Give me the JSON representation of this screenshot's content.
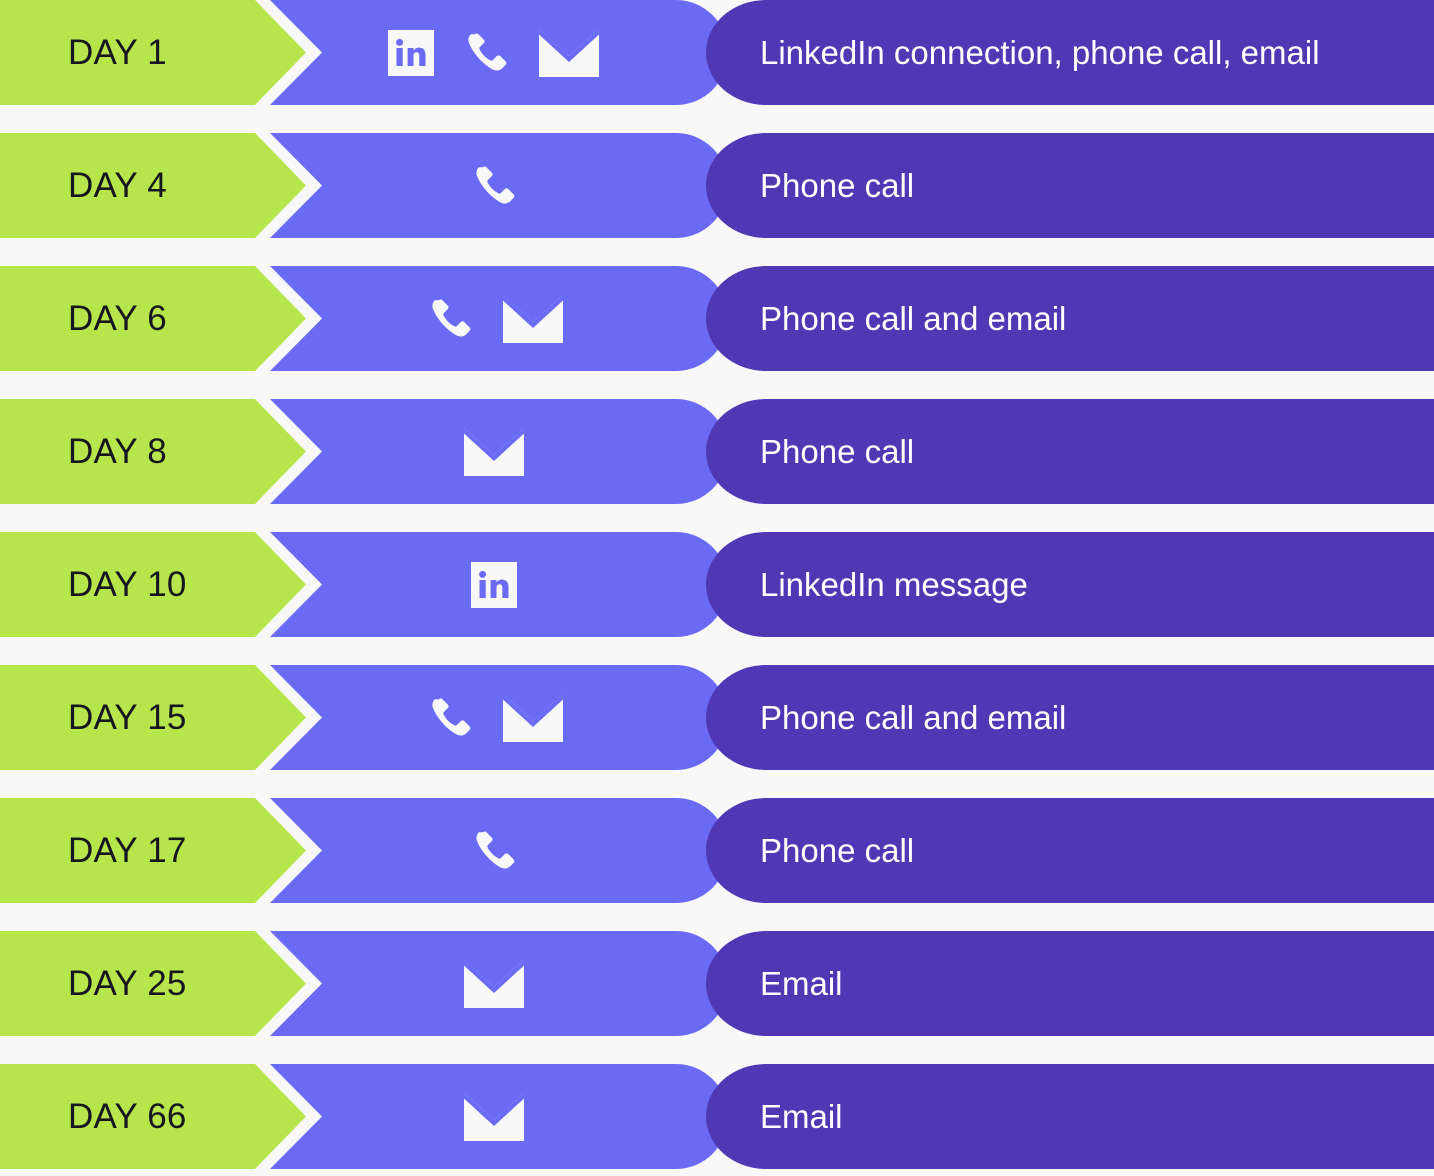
{
  "meta": {
    "title": "Sales Outreach Cadence Timeline",
    "background_color": "#f8f8f8",
    "day_segment_color": "#b6e64b",
    "icon_segment_color": "#6a6af5",
    "description_segment_color": "#5038b5",
    "day_text_color": "#16161f",
    "description_text_color": "#ffffff"
  },
  "rows": [
    {
      "day": "DAY 1",
      "icons": [
        "linkedin-icon",
        "phone-icon",
        "email-icon"
      ],
      "description": "LinkedIn connection, phone call, email"
    },
    {
      "day": "DAY 4",
      "icons": [
        "phone-icon"
      ],
      "description": "Phone call"
    },
    {
      "day": "DAY 6",
      "icons": [
        "phone-icon",
        "email-icon"
      ],
      "description": "Phone call and email"
    },
    {
      "day": "DAY 8",
      "icons": [
        "email-icon"
      ],
      "description": "Phone call"
    },
    {
      "day": "DAY 10",
      "icons": [
        "linkedin-icon"
      ],
      "description": "LinkedIn message"
    },
    {
      "day": "DAY 15",
      "icons": [
        "phone-icon",
        "email-icon"
      ],
      "description": "Phone call and email"
    },
    {
      "day": "DAY 17",
      "icons": [
        "phone-icon"
      ],
      "description": "Phone call"
    },
    {
      "day": "DAY 25",
      "icons": [
        "email-icon"
      ],
      "description": "Email"
    },
    {
      "day": "DAY 66",
      "icons": [
        "email-icon"
      ],
      "description": "Email"
    }
  ]
}
